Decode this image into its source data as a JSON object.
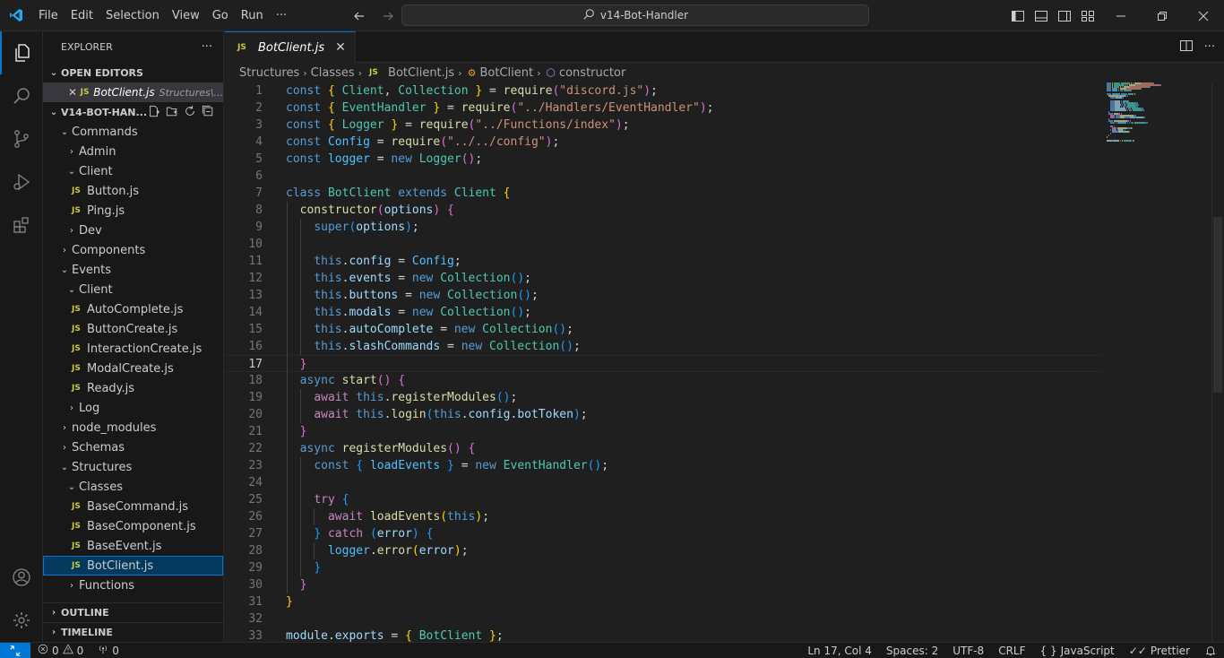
{
  "title_bar": {
    "menu": [
      "File",
      "Edit",
      "Selection",
      "View",
      "Go",
      "Run",
      "···"
    ],
    "search_text": "v14-Bot-Handler"
  },
  "sidebar": {
    "title": "EXPLORER",
    "more": "···",
    "open_editors_label": "OPEN EDITORS",
    "open_editor": {
      "file": "BotClient.js",
      "path": "Structures\\..."
    },
    "project_label": "V14-BOT-HAN...",
    "tree": [
      {
        "label": "Commands",
        "depth": 0,
        "type": "folder",
        "open": true
      },
      {
        "label": "Admin",
        "depth": 1,
        "type": "folder",
        "open": false
      },
      {
        "label": "Client",
        "depth": 1,
        "type": "folder",
        "open": true
      },
      {
        "label": "Button.js",
        "depth": 2,
        "type": "file"
      },
      {
        "label": "Ping.js",
        "depth": 2,
        "type": "file"
      },
      {
        "label": "Dev",
        "depth": 1,
        "type": "folder",
        "open": false
      },
      {
        "label": "Components",
        "depth": 0,
        "type": "folder",
        "open": false
      },
      {
        "label": "Events",
        "depth": 0,
        "type": "folder",
        "open": true
      },
      {
        "label": "Client",
        "depth": 1,
        "type": "folder",
        "open": true
      },
      {
        "label": "AutoComplete.js",
        "depth": 2,
        "type": "file"
      },
      {
        "label": "ButtonCreate.js",
        "depth": 2,
        "type": "file"
      },
      {
        "label": "InteractionCreate.js",
        "depth": 2,
        "type": "file"
      },
      {
        "label": "ModalCreate.js",
        "depth": 2,
        "type": "file"
      },
      {
        "label": "Ready.js",
        "depth": 2,
        "type": "file"
      },
      {
        "label": "Log",
        "depth": 1,
        "type": "folder",
        "open": false
      },
      {
        "label": "node_modules",
        "depth": 0,
        "type": "folder",
        "open": false
      },
      {
        "label": "Schemas",
        "depth": 0,
        "type": "folder",
        "open": false
      },
      {
        "label": "Structures",
        "depth": 0,
        "type": "folder",
        "open": true
      },
      {
        "label": "Classes",
        "depth": 1,
        "type": "folder",
        "open": true
      },
      {
        "label": "BaseCommand.js",
        "depth": 2,
        "type": "file"
      },
      {
        "label": "BaseComponent.js",
        "depth": 2,
        "type": "file"
      },
      {
        "label": "BaseEvent.js",
        "depth": 2,
        "type": "file"
      },
      {
        "label": "BotClient.js",
        "depth": 2,
        "type": "file",
        "selected": true
      },
      {
        "label": "Functions",
        "depth": 1,
        "type": "folder",
        "open": false
      }
    ],
    "outline_label": "OUTLINE",
    "timeline_label": "TIMELINE"
  },
  "editor": {
    "tab": {
      "label": "BotClient.js",
      "icon": "JS",
      "close": "✕"
    },
    "breadcrumbs": [
      "Structures",
      "Classes",
      "BotClient.js",
      "BotClient",
      "constructor"
    ],
    "active_line": 17,
    "lines": [
      [
        [
          "kw",
          "const "
        ],
        [
          "b1",
          "{ "
        ],
        [
          "cls",
          "Client"
        ],
        [
          "pun",
          ", "
        ],
        [
          "cls",
          "Collection"
        ],
        [
          "b1",
          " }"
        ],
        [
          "pun",
          " = "
        ],
        [
          "fn",
          "require"
        ],
        [
          "b2",
          "("
        ],
        [
          "str",
          "\"discord.js\""
        ],
        [
          "b2",
          ")"
        ],
        [
          "pun",
          ";"
        ]
      ],
      [
        [
          "kw",
          "const "
        ],
        [
          "b1",
          "{ "
        ],
        [
          "cls",
          "EventHandler"
        ],
        [
          "b1",
          " }"
        ],
        [
          "pun",
          " = "
        ],
        [
          "fn",
          "require"
        ],
        [
          "b2",
          "("
        ],
        [
          "str",
          "\"../Handlers/EventHandler\""
        ],
        [
          "b2",
          ")"
        ],
        [
          "pun",
          ";"
        ]
      ],
      [
        [
          "kw",
          "const "
        ],
        [
          "b1",
          "{ "
        ],
        [
          "cls",
          "Logger"
        ],
        [
          "b1",
          " }"
        ],
        [
          "pun",
          " = "
        ],
        [
          "fn",
          "require"
        ],
        [
          "b2",
          "("
        ],
        [
          "str",
          "\"../Functions/index\""
        ],
        [
          "b2",
          ")"
        ],
        [
          "pun",
          ";"
        ]
      ],
      [
        [
          "kw",
          "const "
        ],
        [
          "const",
          "Config"
        ],
        [
          "pun",
          " = "
        ],
        [
          "fn",
          "require"
        ],
        [
          "b2",
          "("
        ],
        [
          "str",
          "\"../../config\""
        ],
        [
          "b2",
          ")"
        ],
        [
          "pun",
          ";"
        ]
      ],
      [
        [
          "kw",
          "const "
        ],
        [
          "const",
          "logger"
        ],
        [
          "pun",
          " = "
        ],
        [
          "kw",
          "new "
        ],
        [
          "cls",
          "Logger"
        ],
        [
          "b2",
          "()"
        ],
        [
          "pun",
          ";"
        ]
      ],
      [],
      [
        [
          "kw",
          "class "
        ],
        [
          "cls",
          "BotClient "
        ],
        [
          "kw",
          "extends "
        ],
        [
          "cls",
          "Client "
        ],
        [
          "b1",
          "{"
        ]
      ],
      [
        [
          "pun",
          "  "
        ],
        [
          "fn",
          "constructor"
        ],
        [
          "b2",
          "("
        ],
        [
          "var",
          "options"
        ],
        [
          "b2",
          ")"
        ],
        [
          "pun",
          " "
        ],
        [
          "b2",
          "{"
        ]
      ],
      [
        [
          "pun",
          "    "
        ],
        [
          "kw",
          "super"
        ],
        [
          "b3",
          "("
        ],
        [
          "var",
          "options"
        ],
        [
          "b3",
          ")"
        ],
        [
          "pun",
          ";"
        ]
      ],
      [],
      [
        [
          "pun",
          "    "
        ],
        [
          "kw",
          "this"
        ],
        [
          "pun",
          "."
        ],
        [
          "var",
          "config"
        ],
        [
          "pun",
          " = "
        ],
        [
          "const",
          "Config"
        ],
        [
          "pun",
          ";"
        ]
      ],
      [
        [
          "pun",
          "    "
        ],
        [
          "kw",
          "this"
        ],
        [
          "pun",
          "."
        ],
        [
          "var",
          "events"
        ],
        [
          "pun",
          " = "
        ],
        [
          "kw",
          "new "
        ],
        [
          "cls",
          "Collection"
        ],
        [
          "b3",
          "()"
        ],
        [
          "pun",
          ";"
        ]
      ],
      [
        [
          "pun",
          "    "
        ],
        [
          "kw",
          "this"
        ],
        [
          "pun",
          "."
        ],
        [
          "var",
          "buttons"
        ],
        [
          "pun",
          " = "
        ],
        [
          "kw",
          "new "
        ],
        [
          "cls",
          "Collection"
        ],
        [
          "b3",
          "()"
        ],
        [
          "pun",
          ";"
        ]
      ],
      [
        [
          "pun",
          "    "
        ],
        [
          "kw",
          "this"
        ],
        [
          "pun",
          "."
        ],
        [
          "var",
          "modals"
        ],
        [
          "pun",
          " = "
        ],
        [
          "kw",
          "new "
        ],
        [
          "cls",
          "Collection"
        ],
        [
          "b3",
          "()"
        ],
        [
          "pun",
          ";"
        ]
      ],
      [
        [
          "pun",
          "    "
        ],
        [
          "kw",
          "this"
        ],
        [
          "pun",
          "."
        ],
        [
          "var",
          "autoComplete"
        ],
        [
          "pun",
          " = "
        ],
        [
          "kw",
          "new "
        ],
        [
          "cls",
          "Collection"
        ],
        [
          "b3",
          "()"
        ],
        [
          "pun",
          ";"
        ]
      ],
      [
        [
          "pun",
          "    "
        ],
        [
          "kw",
          "this"
        ],
        [
          "pun",
          "."
        ],
        [
          "var",
          "slashCommands"
        ],
        [
          "pun",
          " = "
        ],
        [
          "kw",
          "new "
        ],
        [
          "cls",
          "Collection"
        ],
        [
          "b3",
          "()"
        ],
        [
          "pun",
          ";"
        ]
      ],
      [
        [
          "pun",
          "  "
        ],
        [
          "b2",
          "}"
        ]
      ],
      [
        [
          "pun",
          "  "
        ],
        [
          "kw",
          "async "
        ],
        [
          "fn",
          "start"
        ],
        [
          "b2",
          "()"
        ],
        [
          "pun",
          " "
        ],
        [
          "b2",
          "{"
        ]
      ],
      [
        [
          "pun",
          "    "
        ],
        [
          "kw2",
          "await "
        ],
        [
          "kw",
          "this"
        ],
        [
          "pun",
          "."
        ],
        [
          "fn",
          "registerModules"
        ],
        [
          "b3",
          "()"
        ],
        [
          "pun",
          ";"
        ]
      ],
      [
        [
          "pun",
          "    "
        ],
        [
          "kw2",
          "await "
        ],
        [
          "kw",
          "this"
        ],
        [
          "pun",
          "."
        ],
        [
          "fn",
          "login"
        ],
        [
          "b3",
          "("
        ],
        [
          "kw",
          "this"
        ],
        [
          "pun",
          "."
        ],
        [
          "var",
          "config"
        ],
        [
          "pun",
          "."
        ],
        [
          "var",
          "botToken"
        ],
        [
          "b3",
          ")"
        ],
        [
          "pun",
          ";"
        ]
      ],
      [
        [
          "pun",
          "  "
        ],
        [
          "b2",
          "}"
        ]
      ],
      [
        [
          "pun",
          "  "
        ],
        [
          "kw",
          "async "
        ],
        [
          "fn",
          "registerModules"
        ],
        [
          "b2",
          "()"
        ],
        [
          "pun",
          " "
        ],
        [
          "b2",
          "{"
        ]
      ],
      [
        [
          "pun",
          "    "
        ],
        [
          "kw",
          "const "
        ],
        [
          "b3",
          "{ "
        ],
        [
          "const",
          "loadEvents"
        ],
        [
          "b3",
          " }"
        ],
        [
          "pun",
          " = "
        ],
        [
          "kw",
          "new "
        ],
        [
          "cls",
          "EventHandler"
        ],
        [
          "b3",
          "()"
        ],
        [
          "pun",
          ";"
        ]
      ],
      [],
      [
        [
          "pun",
          "    "
        ],
        [
          "kw2",
          "try "
        ],
        [
          "b3",
          "{"
        ]
      ],
      [
        [
          "pun",
          "      "
        ],
        [
          "kw2",
          "await "
        ],
        [
          "fn",
          "loadEvents"
        ],
        [
          "b1",
          "("
        ],
        [
          "kw",
          "this"
        ],
        [
          "b1",
          ")"
        ],
        [
          "pun",
          ";"
        ]
      ],
      [
        [
          "pun",
          "    "
        ],
        [
          "b3",
          "}"
        ],
        [
          "pun",
          " "
        ],
        [
          "kw2",
          "catch "
        ],
        [
          "b3",
          "("
        ],
        [
          "var",
          "error"
        ],
        [
          "b3",
          ")"
        ],
        [
          "pun",
          " "
        ],
        [
          "b3",
          "{"
        ]
      ],
      [
        [
          "pun",
          "      "
        ],
        [
          "const",
          "logger"
        ],
        [
          "pun",
          "."
        ],
        [
          "fn",
          "error"
        ],
        [
          "b1",
          "("
        ],
        [
          "var",
          "error"
        ],
        [
          "b1",
          ")"
        ],
        [
          "pun",
          ";"
        ]
      ],
      [
        [
          "pun",
          "    "
        ],
        [
          "b3",
          "}"
        ]
      ],
      [
        [
          "pun",
          "  "
        ],
        [
          "b2",
          "}"
        ]
      ],
      [
        [
          "b1",
          "}"
        ]
      ],
      [],
      [
        [
          "var",
          "module"
        ],
        [
          "pun",
          "."
        ],
        [
          "var",
          "exports"
        ],
        [
          "pun",
          " = "
        ],
        [
          "b1",
          "{ "
        ],
        [
          "cls",
          "BotClient"
        ],
        [
          "b1",
          " }"
        ],
        [
          "pun",
          ";"
        ]
      ]
    ]
  },
  "status_bar": {
    "errors": "0",
    "warnings": "0",
    "ports": "0",
    "position": "Ln 17, Col 4",
    "spaces": "Spaces: 2",
    "encoding": "UTF-8",
    "eol": "CRLF",
    "language": "JavaScript",
    "formatter": "Prettier"
  },
  "colors": {
    "accent": "#0078d4",
    "js_icon": "#cbcb41"
  }
}
